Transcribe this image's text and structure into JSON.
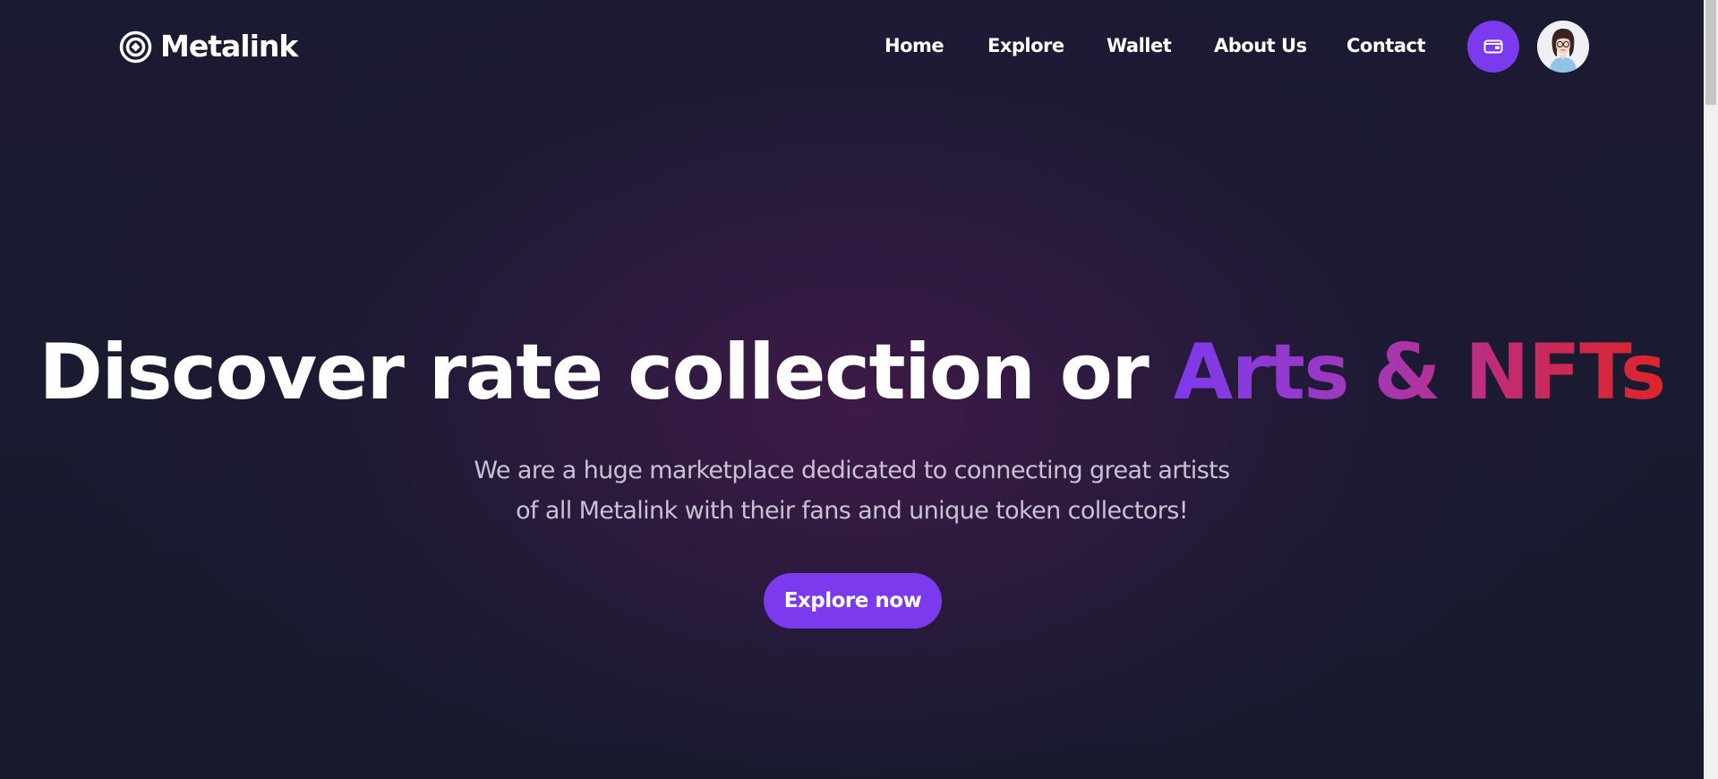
{
  "brand": {
    "name": "Metalink",
    "logo_icon": "target-ring-icon"
  },
  "nav": {
    "items": [
      {
        "label": "Home"
      },
      {
        "label": "Explore"
      },
      {
        "label": "Wallet"
      },
      {
        "label": "About Us"
      },
      {
        "label": "Contact"
      }
    ]
  },
  "header": {
    "wallet_icon": "wallet-icon",
    "avatar_icon": "user-avatar"
  },
  "hero": {
    "title_main": "Discover rate collection or ",
    "title_highlight": "Arts & NFTs",
    "subtitle_line1": "We are a huge marketplace dedicated to connecting great artists",
    "subtitle_line2": "of all Metalink with their fans and unique token collectors!",
    "cta_label": "Explore now"
  },
  "colors": {
    "accent": "#7b3aed",
    "gradient_start": "#7c3aed",
    "gradient_end": "#dc2626",
    "background": "#1a1a30",
    "text_primary": "#ffffff",
    "text_secondary": "#c9c2d3"
  }
}
